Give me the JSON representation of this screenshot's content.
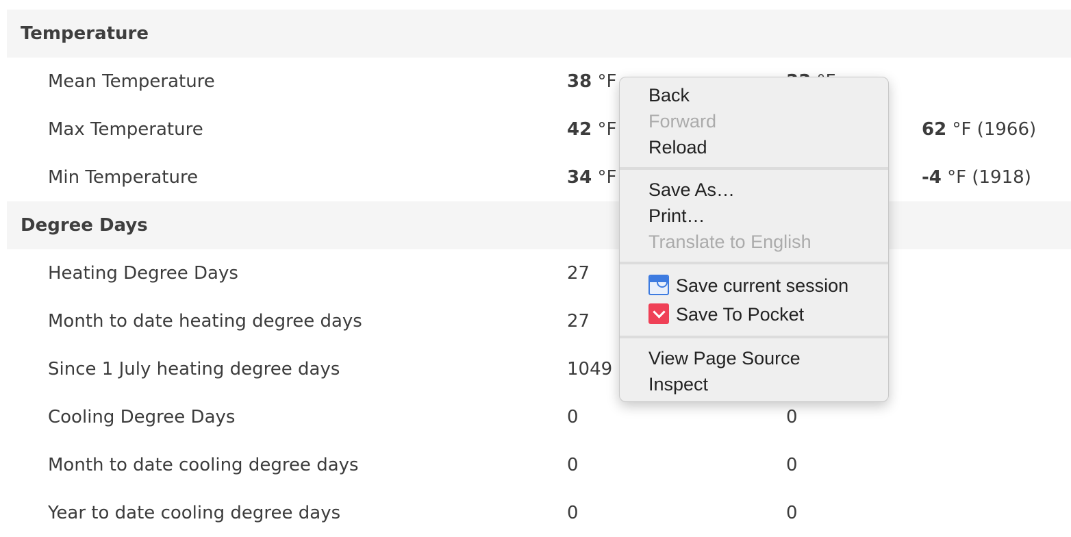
{
  "sections": {
    "temperature": {
      "title": "Temperature",
      "rows": [
        {
          "label": "Mean Temperature",
          "c1_value": "38",
          "c1_unit": "°F",
          "c2_value": "33",
          "c2_unit": "°F",
          "c3_value": "",
          "c3_unit": ""
        },
        {
          "label": "Max Temperature",
          "c1_value": "42",
          "c1_unit": "°F",
          "c2_value": "",
          "c2_unit": "",
          "c3_value": "62",
          "c3_unit": "°F (1966)"
        },
        {
          "label": "Min Temperature",
          "c1_value": "34",
          "c1_unit": "°F",
          "c2_value": "",
          "c2_unit": "",
          "c3_value": "-4",
          "c3_unit": "°F (1918)"
        }
      ]
    },
    "degree_days": {
      "title": "Degree Days",
      "rows": [
        {
          "label": "Heating Degree Days",
          "c1": "27",
          "c2": ""
        },
        {
          "label": "Month to date heating degree days",
          "c1": "27",
          "c2": ""
        },
        {
          "label": "Since 1 July heating degree days",
          "c1": "1049",
          "c2": ""
        },
        {
          "label": "Cooling Degree Days",
          "c1": "0",
          "c2": "0"
        },
        {
          "label": "Month to date cooling degree days",
          "c1": "0",
          "c2": "0"
        },
        {
          "label": "Year to date cooling degree days",
          "c1": "0",
          "c2": "0"
        }
      ]
    }
  },
  "context_menu": {
    "back": "Back",
    "forward": "Forward",
    "reload": "Reload",
    "save_as": "Save As…",
    "print": "Print…",
    "translate": "Translate to English",
    "save_session": "Save current session",
    "save_pocket": "Save To Pocket",
    "view_source": "View Page Source",
    "inspect": "Inspect",
    "icons": {
      "session": "session-buddy-icon",
      "pocket": "pocket-icon"
    },
    "colors": {
      "session": "#3d7be0",
      "pocket": "#ef4056",
      "disabled": "#ababab"
    }
  }
}
